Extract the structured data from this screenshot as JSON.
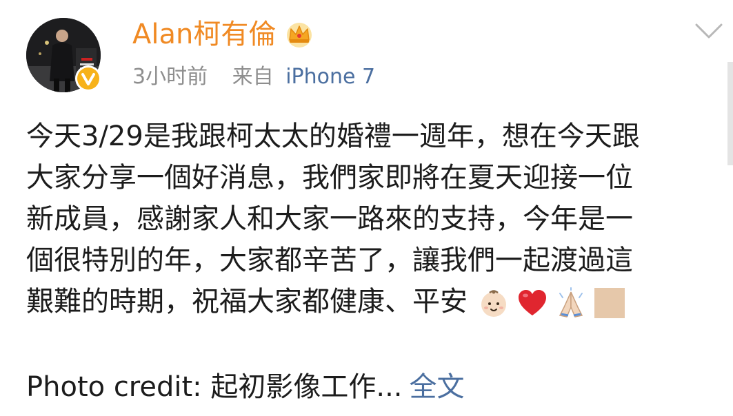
{
  "user": {
    "name": "Alan柯有倫",
    "avatar_icon": "profile-photo",
    "verified_icon": "verified-badge-icon",
    "crown_icon": "crown-icon"
  },
  "meta": {
    "time": "3小时前",
    "source_prefix": "来自",
    "device": "iPhone 7"
  },
  "post": {
    "lines": [
      "今天3/29是我跟柯太太的婚禮一週年，想在今天跟",
      "大家分享一個好消息，我們家即將在夏天迎接一位",
      "新成員，感謝家人和大家一路來的支持，今年是一",
      "個很特別的年，大家都辛苦了，讓我們一起渡過這",
      "艱難的時期，祝福大家都健康、平安"
    ],
    "emojis": [
      "baby-emoji",
      "red-heart-emoji",
      "folded-hands-emoji",
      "skin-tone-emoji"
    ],
    "credit": "Photo credit: 起初影像工作...",
    "full_text_link": "全文"
  },
  "colors": {
    "username": "#f08a24",
    "link": "#4b6fa0",
    "meta": "#8e8e8e",
    "body": "#1c1c1c",
    "heart": "#e0262f"
  }
}
